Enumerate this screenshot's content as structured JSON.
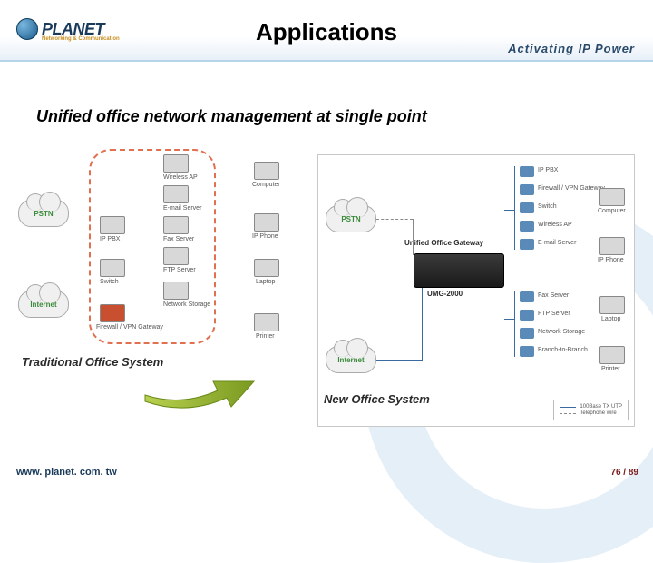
{
  "header": {
    "logo_text": "PLANET",
    "logo_sub": "Networking & Communication",
    "title": "Applications",
    "tagline": "Activating IP Power"
  },
  "subtitle": "Unified office network management at single point",
  "left": {
    "title": "Traditional Office System",
    "cloud1": "PSTN",
    "cloud2": "Internet",
    "col_devices": [
      "Wireless AP",
      "E-mail Server",
      "IP PBX",
      "Fax Server",
      "Switch",
      "FTP Server",
      "Firewall / VPN Gateway",
      "Network Storage"
    ],
    "endpoints": [
      "Computer",
      "IP Phone",
      "Laptop",
      "Printer"
    ]
  },
  "right": {
    "title": "New Office System",
    "cloud1": "PSTN",
    "cloud2": "Internet",
    "gateway_label": "Unified Office Gateway",
    "gateway_model": "UMG-2000",
    "services": [
      "IP PBX",
      "Firewall / VPN Gateway",
      "Switch",
      "Wireless AP",
      "E-mail Server",
      "Fax Server",
      "FTP Server",
      "Network Storage",
      "Branch-to-Branch"
    ],
    "endpoints": [
      "Computer",
      "IP Phone",
      "Laptop",
      "Printer"
    ],
    "legend": {
      "l1": "100Base TX UTP",
      "l2": "Telephone wire"
    }
  },
  "footer": {
    "url": "www. planet. com. tw",
    "page": "76 / 89"
  }
}
